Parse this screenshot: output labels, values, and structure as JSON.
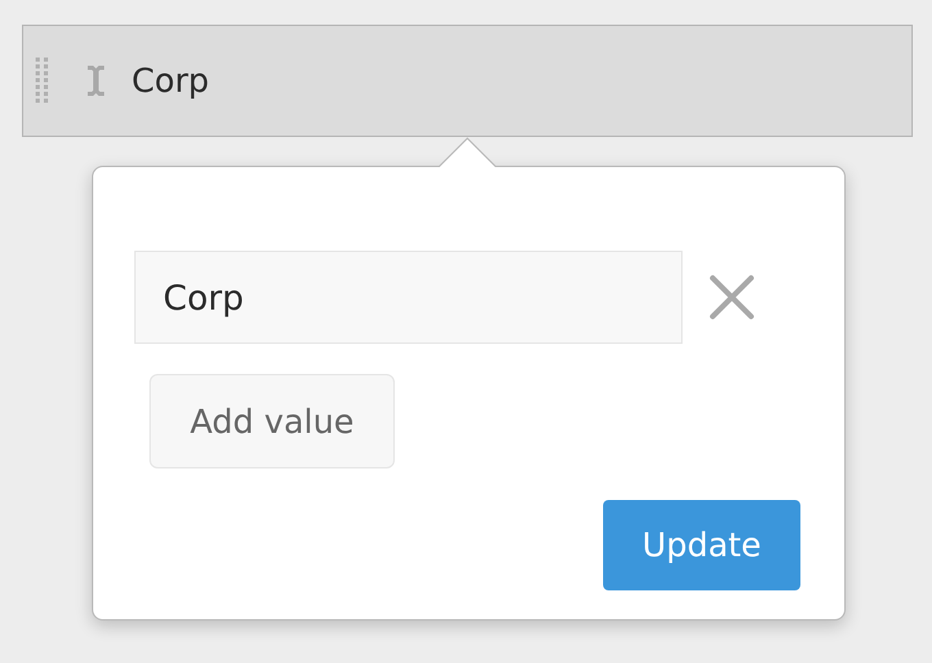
{
  "filter_pill": {
    "label": "Corp"
  },
  "popover": {
    "values": [
      {
        "value": "Corp"
      }
    ],
    "add_button": "Add value",
    "submit_button": "Update"
  }
}
